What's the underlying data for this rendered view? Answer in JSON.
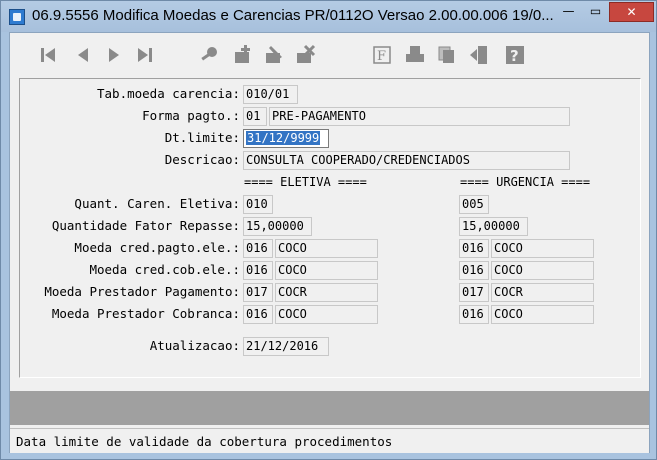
{
  "window": {
    "title": "06.9.5556   Modifica  Moedas e Carencias PR/0112O Versao 2.00.00.006 19/0...",
    "minimize_label": "—",
    "maximize_label": "▭",
    "close_label": "✕"
  },
  "toolbar": {
    "icons": [
      "first-icon",
      "prev-icon",
      "next-icon",
      "last-icon",
      "key-icon",
      "add-icon",
      "edit-icon",
      "delete-icon",
      "filter-icon",
      "print-icon",
      "copy-icon",
      "exit-icon",
      "help-icon"
    ]
  },
  "form": {
    "tab_moeda_label": "Tab.moeda carencia:",
    "tab_moeda_value": "010/01",
    "forma_pagto_label": "Forma pagto.:",
    "forma_pagto_code": "01",
    "forma_pagto_desc": "PRE-PAGAMENTO",
    "dt_limite_label": "Dt.limite:",
    "dt_limite_value": "31/12/9999",
    "descricao_label": "Descricao:",
    "descricao_value": "CONSULTA COOPERADO/CREDENCIADOS",
    "eletiva_header": "==== ELETIVA ====",
    "urgencia_header": "==== URGENCIA ====",
    "quant_caren_label": "Quant. Caren. Eletiva:",
    "quant_caren_eletiva": "010",
    "quant_caren_urgencia": "005",
    "qtd_fator_label": "Quantidade Fator Repasse:",
    "qtd_fator_eletiva": "15,00000",
    "qtd_fator_urgencia": "15,00000",
    "rows": [
      {
        "label": "Moeda cred.pagto.ele.:",
        "el_code": "016",
        "el_desc": "COCO",
        "ur_code": "016",
        "ur_desc": "COCO"
      },
      {
        "label": "Moeda cred.cob.ele.:",
        "el_code": "016",
        "el_desc": "COCO",
        "ur_code": "016",
        "ur_desc": "COCO"
      },
      {
        "label": "Moeda Prestador Pagamento:",
        "el_code": "017",
        "el_desc": "COCR",
        "ur_code": "017",
        "ur_desc": "COCR"
      },
      {
        "label": "Moeda Prestador Cobranca:",
        "el_code": "016",
        "el_desc": "COCO",
        "ur_code": "016",
        "ur_desc": "COCO"
      }
    ],
    "atualizacao_label": "Atualizacao:",
    "atualizacao_value": "21/12/2016"
  },
  "status": {
    "message": "Data limite de validade da cobertura procedimentos"
  }
}
